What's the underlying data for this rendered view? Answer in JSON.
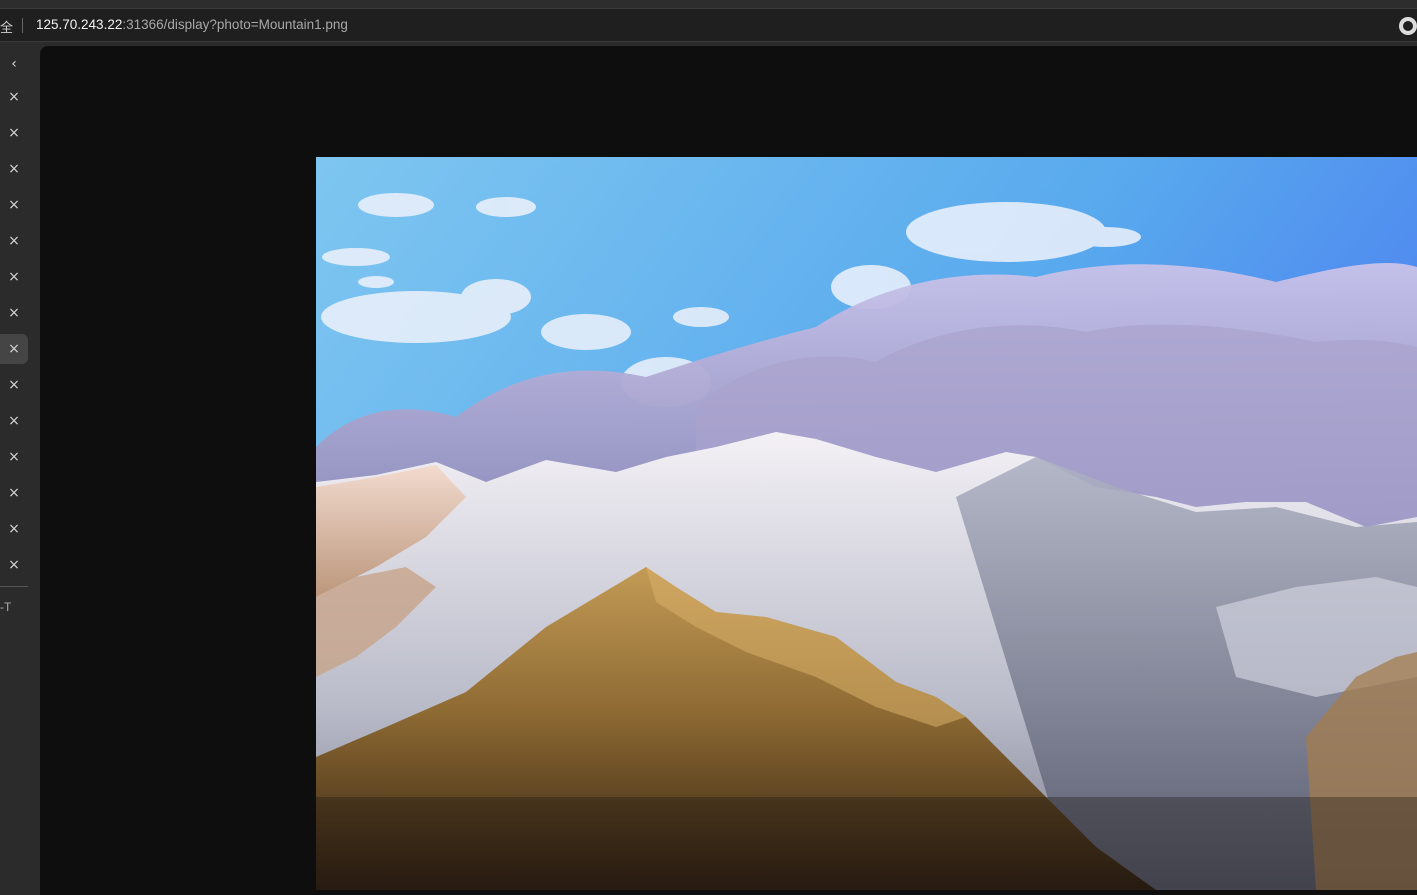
{
  "browser": {
    "secure_label": "全",
    "url_host": "125.70.243.22",
    "url_rest": ":31366/display?photo=Mountain1.png",
    "right_icon": "refresh-icon"
  },
  "sidebar": {
    "back_icon": "‹",
    "close_glyph": "×",
    "tab_count": 14,
    "active_index": 7,
    "footer_label": "-T"
  },
  "photo": {
    "name": "Mountain1.png",
    "description_icon": "image"
  }
}
